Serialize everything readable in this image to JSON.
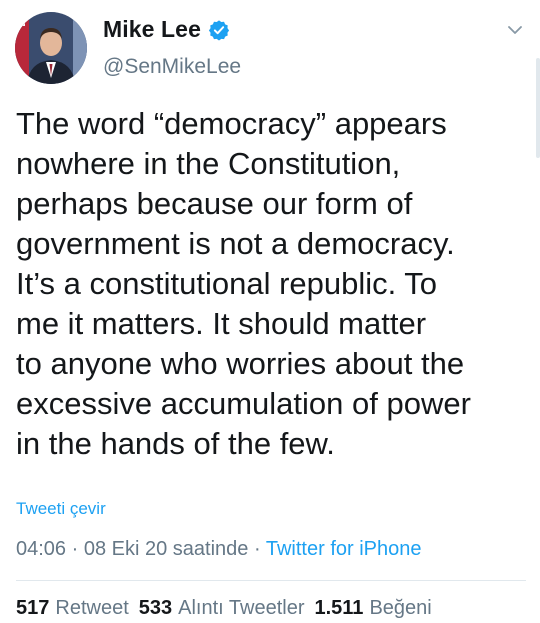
{
  "user": {
    "display_name": "Mike Lee",
    "handle": "@SenMikeLee",
    "verified": true
  },
  "tweet": {
    "text": "The word “democracy” appears\nnowhere in the Constitution,\nperhaps because our form of\ngovernment is not a democracy.\nIt’s a constitutional republic.  To\nme it matters.  It should matter\nto anyone who worries about the\nexcessive accumulation of power\nin the hands of the few.",
    "translate_label": "Tweeti çevir",
    "time": "04:06",
    "separator": "·",
    "date": "08 Eki 20 saatinde",
    "source": "Twitter for iPhone"
  },
  "stats": {
    "retweets_count": "517",
    "retweets_label": "Retweet",
    "quotes_count": "533",
    "quotes_label": "Alıntı Tweetler",
    "likes_count": "1.511",
    "likes_label": "Beğeni"
  },
  "colors": {
    "accent": "#1da1f2",
    "secondary_text": "#657786",
    "primary_text": "#14171a"
  },
  "icons": {
    "verified": "verified-badge-icon",
    "menu": "chevron-down-icon"
  }
}
